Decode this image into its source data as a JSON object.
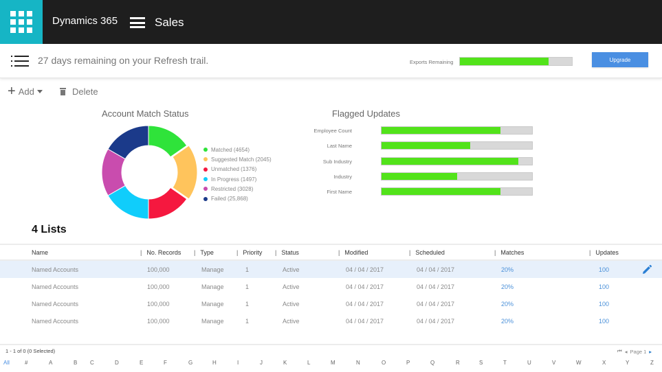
{
  "header": {
    "brand": "Dynamics 365",
    "app_name": "Sales",
    "brand_color": "#16b5c5"
  },
  "notice": {
    "text": "27 days remaining on your Refresh trail.",
    "exports_label": "Exports Remaining",
    "exports_remaining_fraction": 0.79,
    "upgrade_label": "Upgrade"
  },
  "toolbar": {
    "add_label": "Add",
    "delete_label": "Delete"
  },
  "chart_data": [
    {
      "type": "pie",
      "title": "Account Match Status",
      "donut": true,
      "categories": [
        "Matched (4654)",
        "Suggested Match (2045)",
        "Unmatched (1376)",
        "In Progress (1497)",
        "Restricted (3028)",
        "Failed (25,868)"
      ],
      "values": [
        4654,
        2045,
        1376,
        1497,
        3028,
        25868
      ],
      "displayed_slice_fractions": [
        0.153,
        0.194,
        0.153,
        0.167,
        0.166,
        0.167
      ],
      "colors": [
        "#2fe33a",
        "#ffc45c",
        "#f5183f",
        "#10cdfb",
        "#c94cae",
        "#1b3a8a"
      ],
      "exploded_slice": "Suggested Match (2045)",
      "legend": "right"
    },
    {
      "type": "bar",
      "orientation": "horizontal",
      "title": "Flagged Updates",
      "categories": [
        "Employee Count",
        "Last Name",
        "Sub Industry",
        "Industry",
        "First Name"
      ],
      "values": [
        0.79,
        0.59,
        0.91,
        0.5,
        0.79
      ],
      "ylim": [
        0,
        1
      ],
      "fill_color": "#52e31a",
      "track_color": "#d8d8d8"
    }
  ],
  "lists": {
    "title": "4 Lists",
    "columns": [
      "Name",
      "No. Records",
      "Type",
      "Priority",
      "Status",
      "Modified",
      "Scheduled",
      "Matches",
      "Updates"
    ],
    "rows": [
      {
        "name": "Named Accounts",
        "records": "100,000",
        "type": "Manage",
        "priority": "1",
        "status": "Active",
        "modified": "04 / 04 / 2017",
        "scheduled": "04 / 04 / 2017",
        "matches": "20%",
        "updates": "100",
        "selected": true
      },
      {
        "name": "Named Accounts",
        "records": "100,000",
        "type": "Manage",
        "priority": "1",
        "status": "Active",
        "modified": "04 / 04 / 2017",
        "scheduled": "04 / 04 / 2017",
        "matches": "20%",
        "updates": "100",
        "selected": false
      },
      {
        "name": "Named Accounts",
        "records": "100,000",
        "type": "Manage",
        "priority": "1",
        "status": "Active",
        "modified": "04 / 04 / 2017",
        "scheduled": "04 / 04 / 2017",
        "matches": "20%",
        "updates": "100",
        "selected": false
      },
      {
        "name": "Named Accounts",
        "records": "100,000",
        "type": "Manage",
        "priority": "1",
        "status": "Active",
        "modified": "04 / 04 / 2017",
        "scheduled": "04 / 04 / 2017",
        "matches": "20%",
        "updates": "100",
        "selected": false
      }
    ]
  },
  "footer": {
    "record_count": "1 - 1 of 0 (0 Selected)",
    "page_label": "Page 1",
    "alphabet": [
      "All",
      "#",
      "A",
      "B",
      "C",
      "D",
      "E",
      "F",
      "G",
      "H",
      "I",
      "J",
      "K",
      "L",
      "M",
      "N",
      "O",
      "P",
      "Q",
      "R",
      "S",
      "T",
      "U",
      "V",
      "W",
      "X",
      "Y",
      "Z"
    ],
    "active_letter": "All"
  }
}
